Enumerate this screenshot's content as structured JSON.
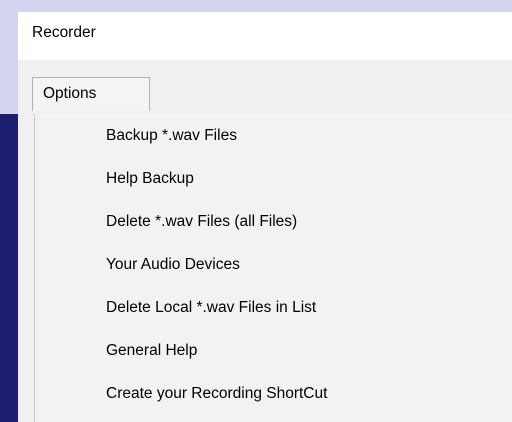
{
  "window": {
    "title": "Recorder"
  },
  "menu": {
    "tab_label": "Options",
    "items": [
      {
        "label": "Backup *.wav Files"
      },
      {
        "label": "Help Backup"
      },
      {
        "label": "Delete *.wav Files (all Files)"
      },
      {
        "label": "Your Audio Devices"
      },
      {
        "label": "Delete Local *.wav Files in List"
      },
      {
        "label": "General Help"
      },
      {
        "label": "Create your Recording ShortCut"
      }
    ]
  },
  "colors": {
    "background": "#d4d4ee",
    "accent": "#1e1d6e",
    "menu_background": "#f2f2f2"
  }
}
